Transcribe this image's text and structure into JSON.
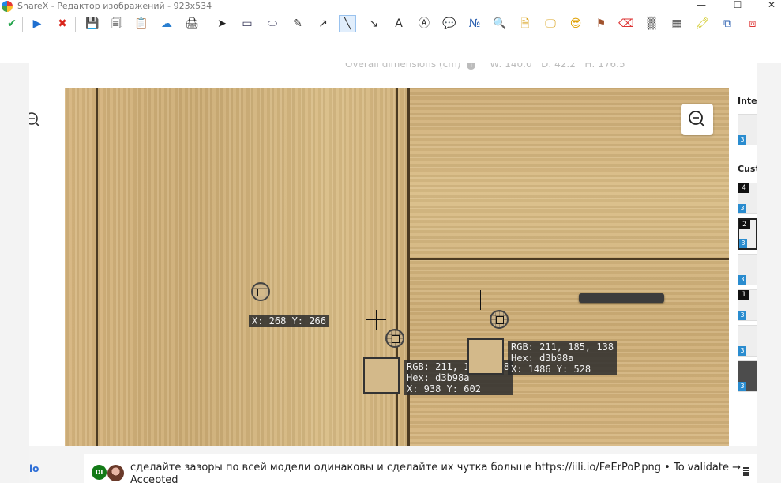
{
  "window": {
    "title": "ShareX - Редактор изображений - 923x534",
    "minimize": "—",
    "maximize": "☐",
    "close": "✕"
  },
  "toolbar": {
    "items": [
      {
        "name": "confirm-icon",
        "glyph": "✔",
        "color": "#22a34a"
      },
      {
        "name": "continue-icon",
        "glyph": "▶",
        "color": "#1e6fd0"
      },
      {
        "name": "cancel-icon",
        "glyph": "✖",
        "color": "#d9261c"
      },
      {
        "name": "save-icon",
        "glyph": "💾",
        "color": "#333"
      },
      {
        "name": "save-as-icon",
        "glyph": "🗐",
        "color": "#333"
      },
      {
        "name": "copy-icon",
        "glyph": "📋",
        "color": "#333"
      },
      {
        "name": "upload-icon",
        "glyph": "☁",
        "color": "#2a7fd0"
      },
      {
        "name": "print-icon",
        "glyph": "🖨",
        "color": "#333"
      },
      {
        "name": "select-cursor-icon",
        "glyph": "➤",
        "color": "#222"
      },
      {
        "name": "rectangle-icon",
        "glyph": "▭",
        "color": "#335"
      },
      {
        "name": "ellipse-icon",
        "glyph": "⬭",
        "color": "#335"
      },
      {
        "name": "freehand-icon",
        "glyph": "✎",
        "color": "#333"
      },
      {
        "name": "freehand-arrow-icon",
        "glyph": "↗",
        "color": "#333"
      },
      {
        "name": "line-icon",
        "glyph": "╲",
        "color": "#333"
      },
      {
        "name": "arrow-icon",
        "glyph": "↘",
        "color": "#333"
      },
      {
        "name": "text-icon",
        "glyph": "A",
        "color": "#333"
      },
      {
        "name": "text-background-icon",
        "glyph": "Ⓐ",
        "color": "#333"
      },
      {
        "name": "speech-balloon-icon",
        "glyph": "💬",
        "color": "#2a7fd0"
      },
      {
        "name": "step-icon",
        "glyph": "№",
        "color": "#2a5fb0"
      },
      {
        "name": "magnify-icon",
        "glyph": "🔍",
        "color": "#2a7fd0"
      },
      {
        "name": "image-file-icon",
        "glyph": "🗎",
        "color": "#d9a21c"
      },
      {
        "name": "image-screen-icon",
        "glyph": "🖵",
        "color": "#d9a21c"
      },
      {
        "name": "sticker-icon",
        "glyph": "😎",
        "color": "#e0a000"
      },
      {
        "name": "cursor-stamp-icon",
        "glyph": "⚑",
        "color": "#a0522d"
      },
      {
        "name": "eraser-icon",
        "glyph": "⌫",
        "color": "#d33"
      },
      {
        "name": "blur-icon",
        "glyph": "▒",
        "color": "#555"
      },
      {
        "name": "pixelate-icon",
        "glyph": "▦",
        "color": "#555"
      },
      {
        "name": "highlight-icon",
        "glyph": "🖍",
        "color": "#c9c000"
      },
      {
        "name": "crop-icon",
        "glyph": "⧉",
        "color": "#2a5fb0"
      },
      {
        "name": "cut-out-icon",
        "glyph": "⧈",
        "color": "#d33"
      }
    ]
  },
  "page": {
    "dims_label": "Overall dimensions (cm)",
    "dims_w": "W: 140.0",
    "dims_d": "D: 42.2",
    "dims_h": "H: 176.5"
  },
  "sidebar": {
    "section1": "Inter",
    "section2": "Cust",
    "thumbs": [
      {
        "num": "",
        "badge": "3",
        "dark": false,
        "sel": false
      },
      {
        "num": "4",
        "badge": "3",
        "dark": false,
        "sel": false
      },
      {
        "num": "2",
        "badge": "3",
        "dark": false,
        "sel": true
      },
      {
        "num": "",
        "badge": "3",
        "dark": false,
        "sel": false
      },
      {
        "num": "1",
        "badge": "3",
        "dark": false,
        "sel": false
      },
      {
        "num": "",
        "badge": "3",
        "dark": false,
        "sel": false
      },
      {
        "num": "",
        "badge": "3",
        "dark": true,
        "sel": false
      }
    ]
  },
  "annotations": {
    "label_a": "X: 268 Y: 266",
    "picker_b": {
      "rgb": "RGB: 211, 185, 138",
      "hex": "Hex: d3b98a",
      "xy": "X: 938 Y: 602"
    },
    "picker_c": {
      "rgb": "RGB: 211, 185, 138",
      "hex": "Hex: d3b98a",
      "xy": "X: 1486 Y: 528"
    },
    "swatch_color": "#d3b98a"
  },
  "comment": {
    "avatar_initials": "DI",
    "text": "сделайте зазоры по всей модели одинаковы и сделайте их чутка больше https://iili.io/FeErPoP.png • To validate → Accepted",
    "left_link": "lo"
  }
}
